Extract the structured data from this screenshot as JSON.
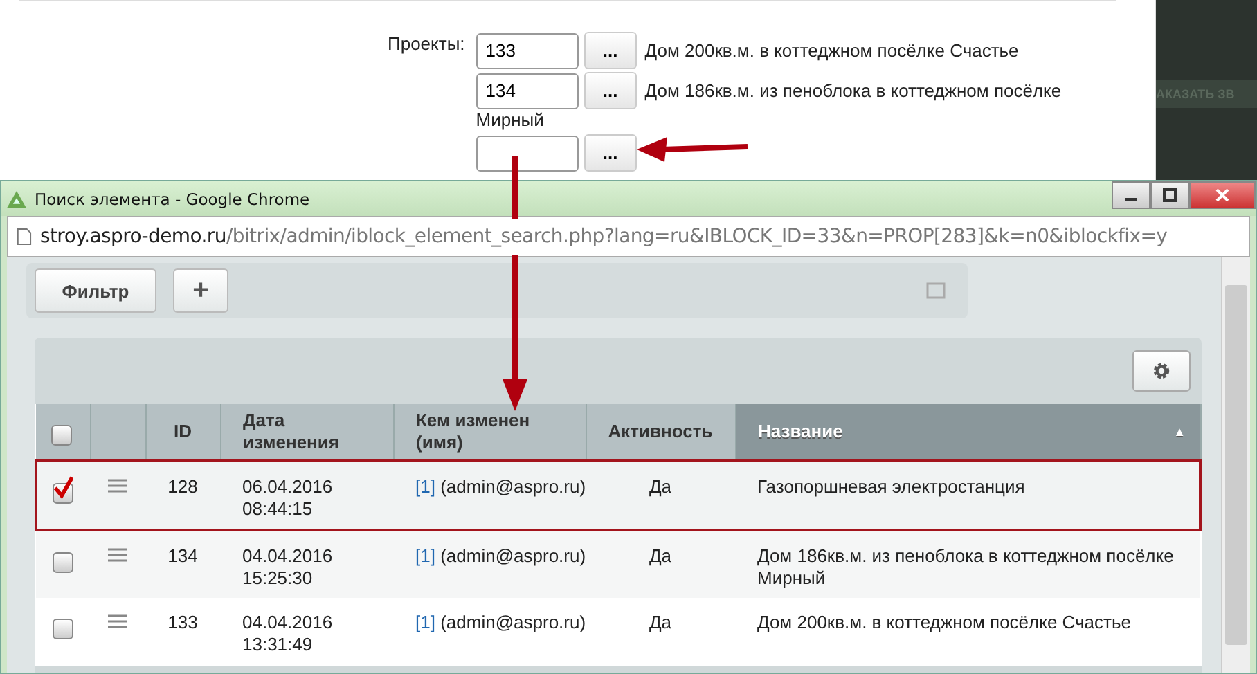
{
  "page": {
    "fields_label": "Проекты:",
    "fields": [
      {
        "value": "133",
        "button": "...",
        "caption": "Дом 200кв.м. в коттеджном посёлке Счастье"
      },
      {
        "value": "134",
        "button": "...",
        "caption": "Дом 186кв.м. из пеноблока в коттеджном посёлке",
        "caption_wrap": "Мирный"
      },
      {
        "button": "..."
      }
    ],
    "side_button": "АКАЗАТЬ ЗВ"
  },
  "popup": {
    "title": "Поиск элемента - Google Chrome",
    "url_host": "stroy.aspro-demo.ru",
    "url_path": "/bitrix/admin/iblock_element_search.php?lang=ru&IBLOCK_ID=33&n=PROP[283]&k=n0&iblockfix=y",
    "filter_button": "Фильтр",
    "add_button": "+",
    "columns": [
      {
        "label": "ID",
        "sorted": false
      },
      {
        "label": "Дата изменения",
        "sorted": false
      },
      {
        "label": "Кем изменен (имя)",
        "sorted": false
      },
      {
        "label": "Активность",
        "sorted": false
      },
      {
        "label": "Название",
        "sorted": true
      }
    ],
    "sort_mark": "▲",
    "all_checked": false,
    "rows": [
      {
        "id": "128",
        "date": "06.04.2016",
        "time": "08:44:15",
        "user_link": "[1]",
        "user": "(admin@aspro.ru)",
        "active": "Да",
        "name": "Газопоршневая электростанция",
        "checked": true,
        "selected": true
      },
      {
        "id": "134",
        "date": "04.04.2016",
        "time": "15:25:30",
        "user_link": "[1]",
        "user": "(admin@aspro.ru)",
        "active": "Да",
        "name": "Дом 186кв.м. из пеноблока в коттеджном посёлке Мирный",
        "checked": false,
        "selected": false
      },
      {
        "id": "133",
        "date": "04.04.2016",
        "time": "13:31:49",
        "user_link": "[1]",
        "user": "(admin@aspro.ru)",
        "active": "Да",
        "name": "Дом 200кв.м. в коттеджном посёлке Счастье",
        "checked": false,
        "selected": false
      }
    ]
  }
}
